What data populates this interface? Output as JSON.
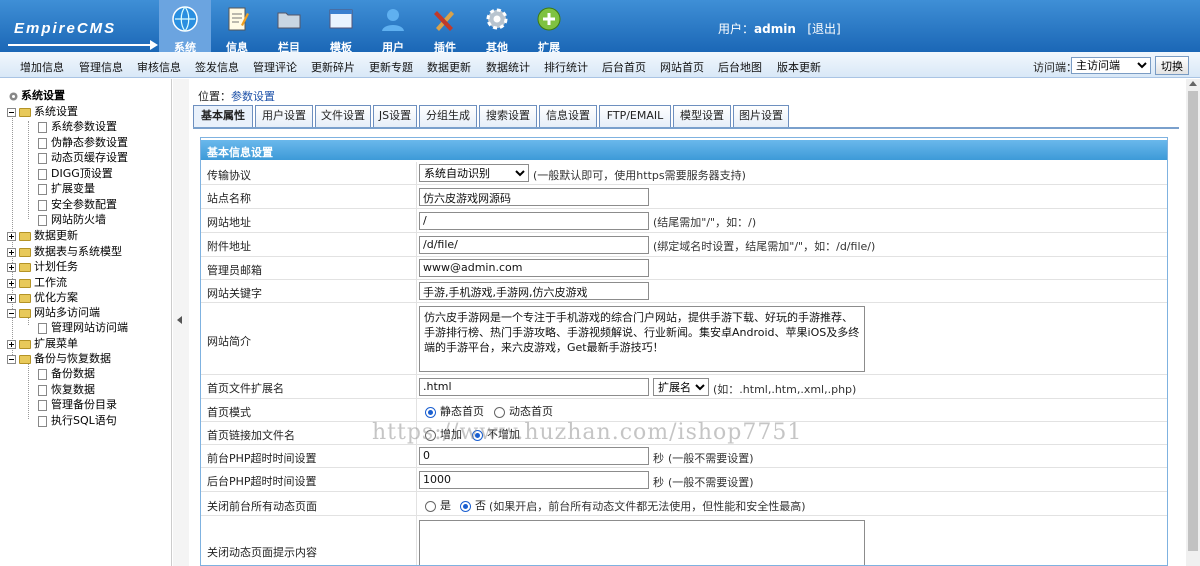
{
  "logo": {
    "text": "EmpireCMS"
  },
  "topnav": [
    {
      "label": "系统",
      "icon": "globe-icon",
      "active": true
    },
    {
      "label": "信息",
      "icon": "notepad-icon"
    },
    {
      "label": "栏目",
      "icon": "folder-icon"
    },
    {
      "label": "模板",
      "icon": "template-icon"
    },
    {
      "label": "用户",
      "icon": "user-icon"
    },
    {
      "label": "插件",
      "icon": "tools-icon"
    },
    {
      "label": "其他",
      "icon": "gear-icon"
    },
    {
      "label": "扩展",
      "icon": "plus-icon"
    }
  ],
  "user": {
    "prefix": "用户：",
    "name": "admin",
    "logout": "[退出]"
  },
  "subnav": [
    "增加信息",
    "管理信息",
    "审核信息",
    "签发信息",
    "管理评论",
    "更新碎片",
    "更新专题",
    "数据更新",
    "数据统计",
    "排行统计",
    "后台首页",
    "网站首页",
    "后台地图",
    "版本更新"
  ],
  "visit": {
    "label": "访问端：",
    "selected": "主访问端",
    "switch": "切换"
  },
  "tree": {
    "title": "系统设置",
    "groups": [
      {
        "label": "系统设置",
        "children": [
          "系统参数设置",
          "伪静态参数设置",
          "动态页缓存设置",
          "DIGG顶设置",
          "扩展变量",
          "安全参数配置",
          "网站防火墙"
        ]
      },
      {
        "label": "数据更新"
      },
      {
        "label": "数据表与系统模型"
      },
      {
        "label": "计划任务"
      },
      {
        "label": "工作流"
      },
      {
        "label": "优化方案"
      },
      {
        "label": "网站多访问端",
        "children": [
          "管理网站访问端"
        ]
      },
      {
        "label": "扩展菜单"
      },
      {
        "label": "备份与恢复数据",
        "children": [
          "备份数据",
          "恢复数据",
          "管理备份目录",
          "执行SQL语句"
        ]
      }
    ]
  },
  "breadcrumb": {
    "prefix": "位置：",
    "link": "参数设置"
  },
  "tabs": [
    "基本属性",
    "用户设置",
    "文件设置",
    "JS设置",
    "分组生成",
    "搜索设置",
    "信息设置",
    "FTP/EMAIL",
    "模型设置",
    "图片设置"
  ],
  "panel": {
    "title": "基本信息设置",
    "protocol": {
      "label": "传输协议",
      "value": "系统自动识别",
      "hint": "(一般默认即可，使用https需要服务器支持)"
    },
    "sitename": {
      "label": "站点名称",
      "value": "仿六皮游戏网源码"
    },
    "siteurl": {
      "label": "网站地址",
      "value": "/",
      "hint": "(结尾需加\"/\"，如：/)"
    },
    "fileurl": {
      "label": "附件地址",
      "value": "/d/file/",
      "hint": "(绑定域名时设置，结尾需加\"/\"，如：/d/file/)"
    },
    "email": {
      "label": "管理员邮箱",
      "value": "www@admin.com"
    },
    "keywords": {
      "label": "网站关键字",
      "value": "手游,手机游戏,手游网,仿六皮游戏"
    },
    "intro": {
      "label": "网站简介",
      "value": "仿六皮手游网是一个专注于手机游戏的综合门户网站，提供手游下载、好玩的手游推荐、手游排行榜、热门手游攻略、手游视频解说、行业新闻。集安卓Android、苹果iOS及多终端的手游平台，来六皮游戏，Get最新手游技巧！"
    },
    "ext": {
      "label": "首页文件扩展名",
      "value": ".html",
      "select": "扩展名",
      "hint": "(如：.html,.htm,.xml,.php)"
    },
    "mode": {
      "label": "首页模式",
      "opt1": "静态首页",
      "opt2": "动态首页"
    },
    "addname": {
      "label": "首页链接加文件名",
      "opt1": "增加",
      "opt2": "不增加"
    },
    "fronttimeout": {
      "label": "前台PHP超时时间设置",
      "value": "0",
      "unit": "秒",
      "hint": "(一般不需要设置)"
    },
    "backtimeout": {
      "label": "后台PHP超时时间设置",
      "value": "1000",
      "unit": "秒",
      "hint": "(一般不需要设置)"
    },
    "closedyn": {
      "label": "关闭前台所有动态页面",
      "opt1": "是",
      "opt2": "否",
      "hint": "(如果开启，前台所有动态文件都无法使用，但性能和安全性最高)"
    },
    "closemsg": {
      "label": "关闭动态页面提示内容",
      "value": ""
    }
  },
  "watermark": "https://www.huzhan.com/ishop7751"
}
